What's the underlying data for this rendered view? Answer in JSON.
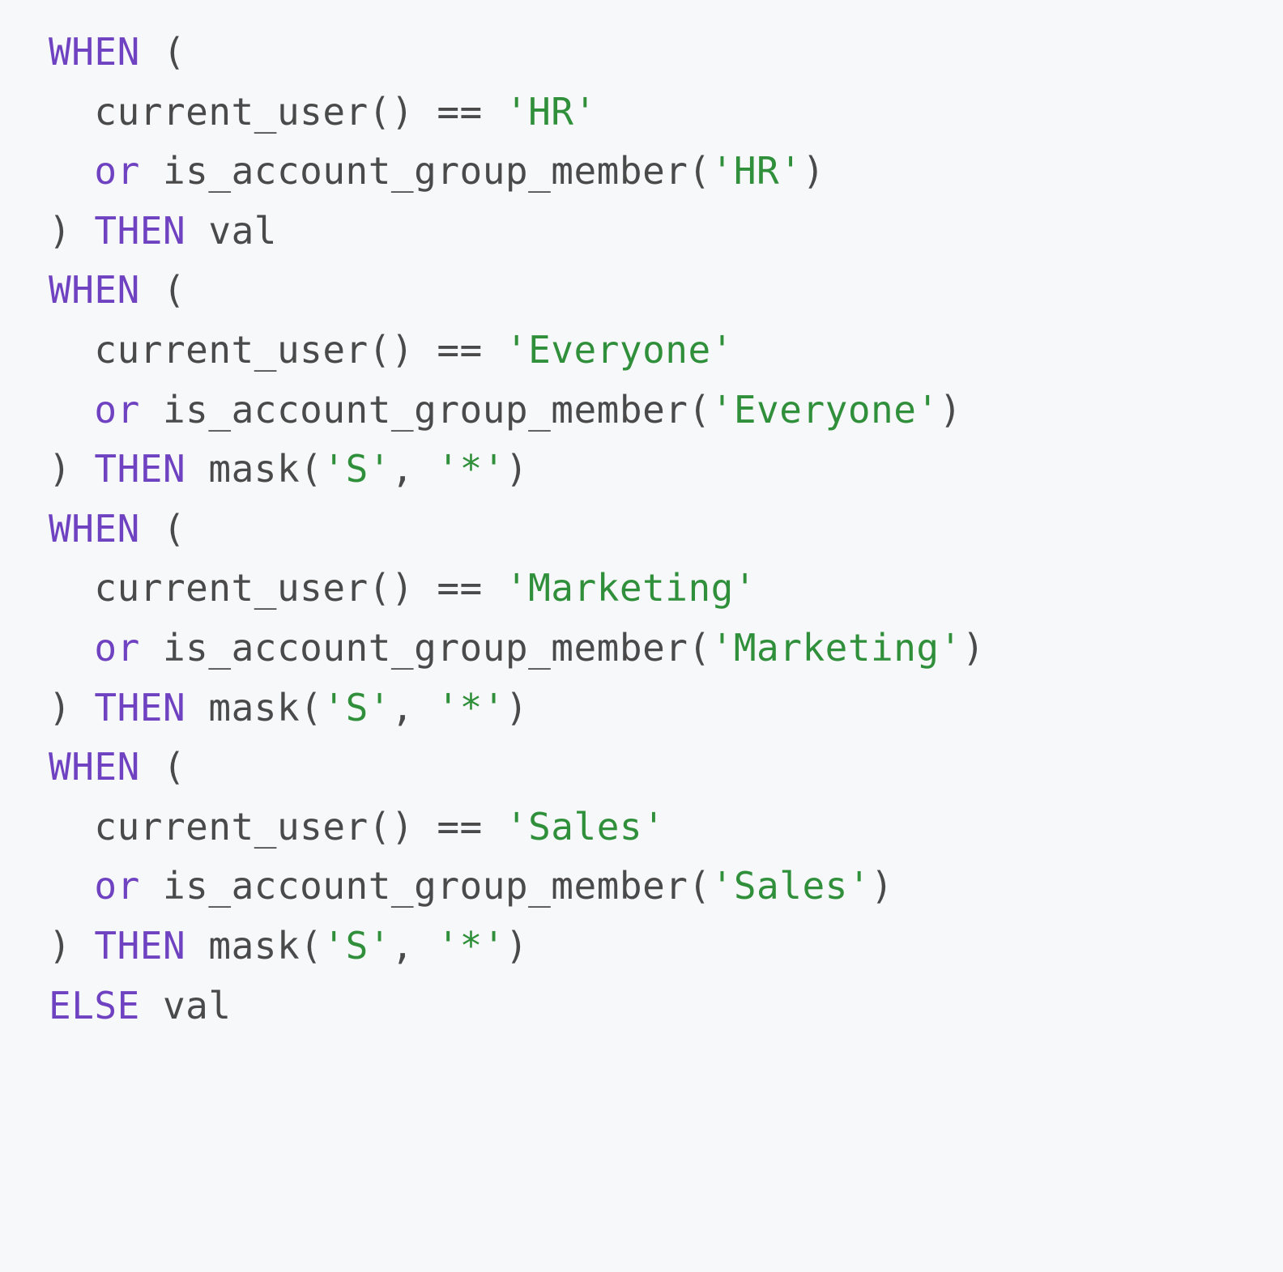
{
  "kw_when": "WHEN",
  "kw_then": "THEN",
  "kw_else": "ELSE",
  "kw_or": "or",
  "op_eq": "==",
  "p_open": "(",
  "p_close": ")",
  "p_open_close": "()",
  "comma": ",",
  "sp": " ",
  "sp2": "  ",
  "fn_current_user": "current_user",
  "fn_is_agm": "is_account_group_member",
  "fn_mask": "mask",
  "id_val": "val",
  "str_hr": "'HR'",
  "str_everyone": "'Everyone'",
  "str_marketing": "'Marketing'",
  "str_sales": "'Sales'",
  "str_S": "'S'",
  "str_star": "'*'"
}
